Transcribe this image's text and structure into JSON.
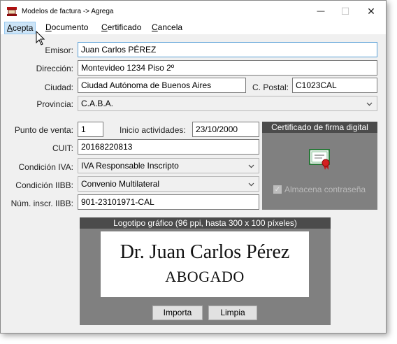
{
  "window": {
    "title": "Modelos de factura -> Agrega",
    "controls": {
      "minimize": "—",
      "maximize": "☐",
      "close": "✕"
    }
  },
  "menu": [
    {
      "label": "Acepta",
      "accel": "A",
      "rest": "cepta"
    },
    {
      "label": "Documento",
      "accel": "D",
      "rest": "ocumento"
    },
    {
      "label": "Certificado",
      "accel": "C",
      "rest": "ertificado"
    },
    {
      "label": "Cancela",
      "accel": "C",
      "rest": "ancela"
    }
  ],
  "form": {
    "emisor": {
      "label": "Emisor:",
      "value": "Juan Carlos PÉREZ"
    },
    "direccion": {
      "label": "Dirección:",
      "value": "Montevideo 1234 Piso 2º"
    },
    "ciudad": {
      "label": "Ciudad:",
      "value": "Ciudad Autónoma de Buenos Aires"
    },
    "cpostal": {
      "label": "C. Postal:",
      "value": "C1023CAL"
    },
    "provincia": {
      "label": "Provincia:",
      "value": "C.A.B.A."
    },
    "punto_venta": {
      "label": "Punto de venta:",
      "value": "1"
    },
    "inicio": {
      "label": "Inicio actividades:",
      "value": "23/10/2000"
    },
    "cuit": {
      "label": "CUIT:",
      "value": "20168220813"
    },
    "cond_iva": {
      "label": "Condición IVA:",
      "value": "IVA Responsable Inscripto"
    },
    "cond_iibb": {
      "label": "Condición IIBB:",
      "value": "Convenio Multilateral"
    },
    "num_iibb": {
      "label": "Núm. inscr. IIBB:",
      "value": "901-23101971-CAL"
    }
  },
  "certificate": {
    "title": "Certificado de firma digital",
    "icon": "certificate-icon",
    "store_password": {
      "label": "Almacena contraseña",
      "checked": true,
      "enabled": false
    }
  },
  "logo": {
    "title": "Logotipo gráfico (96 ppi, hasta 300 x 100 píxeles)",
    "line1": "Dr. Juan Carlos Pérez",
    "line2": "ABOGADO",
    "import_label": "Importa",
    "clear_label": "Limpia"
  },
  "colors": {
    "panel_dark": "#4b4b4b",
    "panel": "#808080",
    "focus": "#5aa0d6",
    "menu_highlight": "#cce4f7"
  }
}
